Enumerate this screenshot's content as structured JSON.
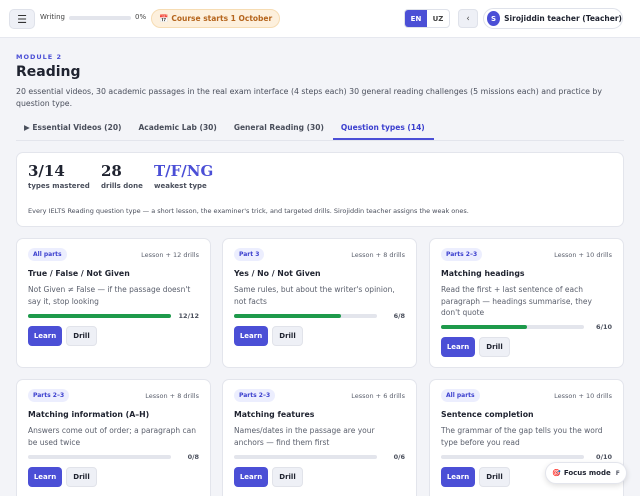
{
  "topbar": {
    "menu_icon": "☰",
    "writing_label": "Writing",
    "writing_progress": 0,
    "writing_percent": "0%",
    "course_icon": "📅",
    "course_text": "Course starts 1 October",
    "languages": [
      "EN",
      "UZ"
    ],
    "active_language": "EN",
    "back_icon": "‹",
    "user_initial": "S",
    "user_name": "Sirojiddin teacher (Teacher)"
  },
  "header": {
    "module": "MODULE 2",
    "title": "Reading",
    "description": "20 essential videos, 30 academic passages in the real exam interface (4 steps each) 30 general reading challenges (5 missions each) and practice by question type."
  },
  "tabs": [
    {
      "label": "▶ Essential Videos (20)",
      "active": false
    },
    {
      "label": "Academic Lab (30)",
      "active": false
    },
    {
      "label": "General Reading (30)",
      "active": false
    },
    {
      "label": "Question types (14)",
      "active": true
    }
  ],
  "summary": {
    "mastered_value": "3/14",
    "mastered_label": "types mastered",
    "drills_value": "28",
    "drills_label": "drills done",
    "weakest_value": "T/F/NG",
    "weakest_label": "weakest type",
    "note": "Every IELTS Reading question type — a short lesson, the examiner's trick, and targeted drills. Sirojiddin teacher assigns the weak ones."
  },
  "cards": [
    {
      "badge": "All parts",
      "lesson": "Lesson + 12 drills",
      "title": "True / False / Not Given",
      "desc": "Not Given ≠ False — if the passage doesn't say it, stop looking",
      "progress": 1.0,
      "count": "12/12",
      "learn": "Learn",
      "drill": "Drill"
    },
    {
      "badge": "Part 3",
      "lesson": "Lesson + 8 drills",
      "title": "Yes / No / Not Given",
      "desc": "Same rules, but about the writer's opinion, not facts",
      "progress": 0.75,
      "count": "6/8",
      "learn": "Learn",
      "drill": "Drill"
    },
    {
      "badge": "Parts 2–3",
      "lesson": "Lesson + 10 drills",
      "title": "Matching headings",
      "desc": "Read the first + last sentence of each paragraph — headings summarise, they don't quote",
      "progress": 0.6,
      "count": "6/10",
      "learn": "Learn",
      "drill": "Drill"
    },
    {
      "badge": "Parts 2–3",
      "lesson": "Lesson + 8 drills",
      "title": "Matching information (A–H)",
      "desc": "Answers come out of order; a paragraph can be used twice",
      "progress": 0,
      "count": "0/8",
      "learn": "Learn",
      "drill": "Drill"
    },
    {
      "badge": "Parts 2–3",
      "lesson": "Lesson + 6 drills",
      "title": "Matching features",
      "desc": "Names/dates in the passage are your anchors — find them first",
      "progress": 0,
      "count": "0/6",
      "learn": "Learn",
      "drill": "Drill"
    },
    {
      "badge": "All parts",
      "lesson": "Lesson + 10 drills",
      "title": "Sentence completion",
      "desc": "The grammar of the gap tells you the word type before you read",
      "progress": 0,
      "count": "0/10",
      "learn": "Learn",
      "drill": "Drill"
    }
  ],
  "focus": {
    "icon": "🎯",
    "label": "Focus mode",
    "key": "F"
  },
  "colors": {
    "accent": "#4b4fd6",
    "progress_green": "#1e9a4b",
    "course_orange": "#b5651d"
  }
}
